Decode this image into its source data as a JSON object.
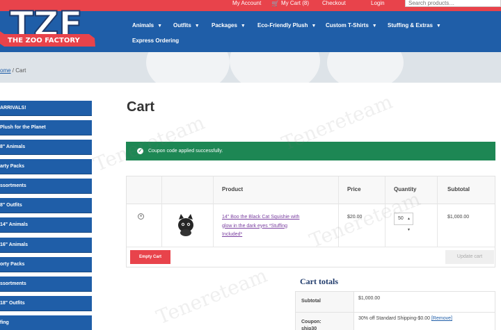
{
  "topbar": {
    "my_account": "My Account",
    "my_cart": "My Cart (8)",
    "checkout": "Checkout",
    "login": "Login",
    "search_placeholder": "Search products…"
  },
  "logo": {
    "letters": "TZF",
    "banner": "THE ZOO FACTORY"
  },
  "nav": {
    "items": [
      {
        "label": "Animals"
      },
      {
        "label": "Outfits"
      },
      {
        "label": "Packages"
      },
      {
        "label": "Eco-Friendly Plush"
      },
      {
        "label": "Custom T-Shirts"
      },
      {
        "label": "Stuffing & Extras"
      },
      {
        "label": "Express Ordering"
      }
    ]
  },
  "breadcrumb": {
    "home": "ome",
    "sep": "/",
    "current": "Cart"
  },
  "sidebar": {
    "items": [
      {
        "label": "ARRIVALS!"
      },
      {
        "label": "Plush for the Planet"
      },
      {
        "label": "8\" Animals"
      },
      {
        "label": "arty Packs"
      },
      {
        "label": "ssortments"
      },
      {
        "label": "8\" Outfits"
      },
      {
        "label": "14\" Animals"
      },
      {
        "label": "16\" Animals"
      },
      {
        "label": "orty Packs"
      },
      {
        "label": "ssortments"
      },
      {
        "label": "18\" Outfits"
      },
      {
        "label": "fing"
      }
    ]
  },
  "main": {
    "title": "Cart",
    "notice": "Coupon code applied successfully.",
    "table": {
      "headers": {
        "product": "Product",
        "price": "Price",
        "quantity": "Quantity",
        "subtotal": "Subtotal"
      },
      "rows": [
        {
          "product": "14\" Boo the Black Cat Squishie with glow in the dark eyes *Stuffing Included*",
          "price": "$20.00",
          "quantity": "50",
          "subtotal": "$1,000.00"
        }
      ],
      "empty_cart": "Empty Cart",
      "update_cart": "Update cart"
    },
    "totals": {
      "title": "Cart totals",
      "subtotal_label": "Subtotal",
      "subtotal_value": "$1,000.00",
      "coupon_label": "Coupon:",
      "coupon_code": "ship30",
      "coupon_value": "30% off Standard Shipping",
      "coupon_amount": "-$0.00",
      "remove_label": "[Remove]"
    }
  },
  "watermark": "Tenereteam",
  "colors": {
    "topbar": "#e8434b",
    "header_blue": "#1f5ea8",
    "notice_green": "#1d8754",
    "empty_cart_red": "#e8434b"
  }
}
